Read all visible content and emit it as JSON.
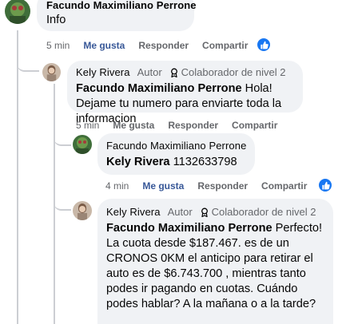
{
  "comments": [
    {
      "author": "Facundo Maximiliano Perrone",
      "text": "Info",
      "time": "5 min",
      "like_label": "Me gusta",
      "reply_label": "Responder",
      "share_label": "Compartir",
      "has_like_reaction": true
    },
    {
      "author": "Kely Rivera",
      "role": "Autor",
      "badge": "Colaborador de nivel 2",
      "mention": "Facundo Maximiliano Perrone",
      "text": " Hola! Dejame tu numero para enviarte toda la informacion",
      "time": "5 min",
      "like_label": "Me gusta",
      "reply_label": "Responder",
      "share_label": "Compartir"
    },
    {
      "author": "Facundo Maximiliano Perrone",
      "mention": "Kely Rivera",
      "text": " 1132633798",
      "time": "4 min",
      "like_label": "Me gusta",
      "reply_label": "Responder",
      "share_label": "Compartir",
      "has_like_reaction": true
    },
    {
      "author": "Kely Rivera",
      "role": "Autor",
      "badge": "Colaborador de nivel 2",
      "mention": "Facundo Maximiliano Perrone",
      "text": " Perfecto! La cuota desde $187.467. es de un CRONOS 0KM el anticipo para retirar el auto es de $6.743.700 , mientras tanto podes ir pagando en cuotas. Cuándo podes hablar? A la mañana o a la tarde?"
    }
  ],
  "colors": {
    "bubble": "#f0f2f5",
    "thread_line": "#ccced3",
    "like_blue": "#1877f2",
    "secondary_text": "#65676b"
  },
  "icons": {
    "badge": "badge-award-icon",
    "like": "thumbs-up-icon"
  }
}
